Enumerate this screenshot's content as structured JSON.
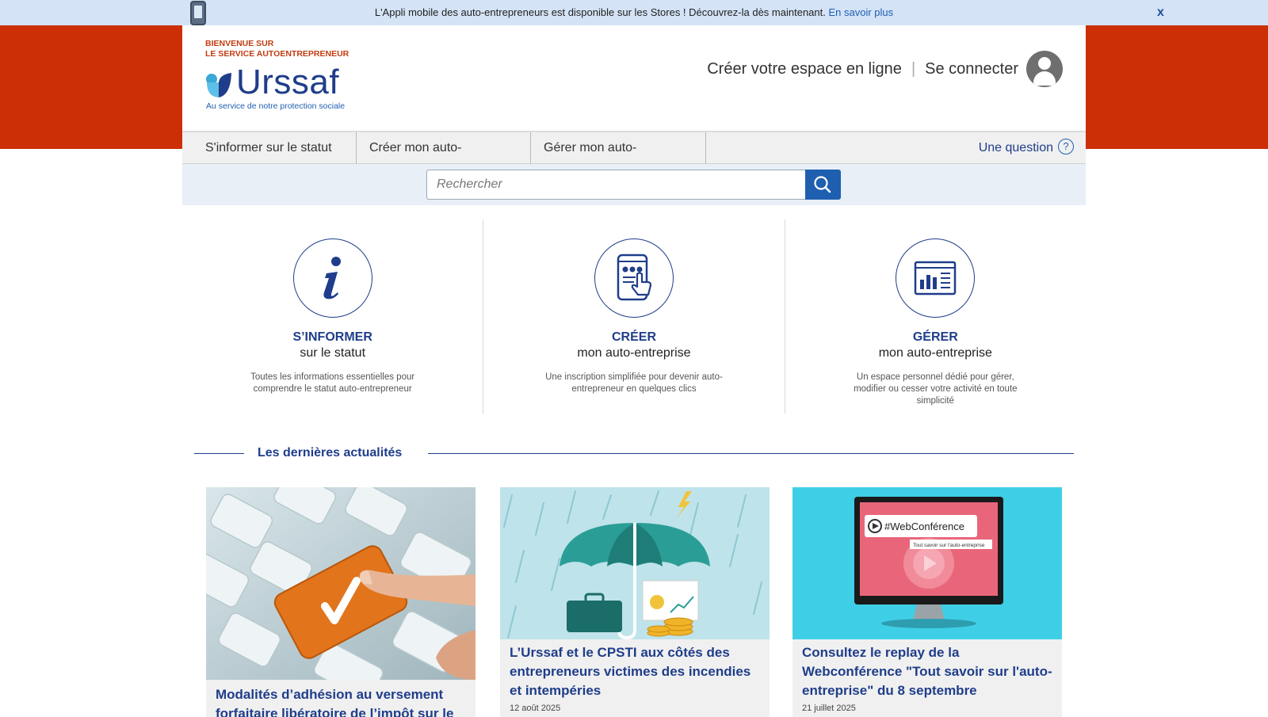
{
  "banner": {
    "text": "L'Appli mobile des auto-entrepreneurs est disponible sur les Stores ! Découvrez-la dès maintenant.",
    "link": "En savoir plus",
    "close": "x"
  },
  "header": {
    "welcome_line1": "BIENVENUE SUR",
    "welcome_line2": "LE SERVICE AUTOENTREPRENEUR",
    "logo_word": "Urssaf",
    "logo_tagline": "Au service de notre protection sociale",
    "create_space": "Créer votre espace en ligne",
    "separator": "|",
    "login": "Se connecter"
  },
  "nav": {
    "items": [
      {
        "label": "S'informer sur le statut"
      },
      {
        "label": "Créer mon auto-entreprise"
      },
      {
        "label": "Gérer mon auto-entreprise"
      }
    ],
    "question": "Une question",
    "question_icon": "?"
  },
  "search": {
    "placeholder": "Rechercher"
  },
  "features": [
    {
      "icon": "info-icon",
      "title": "S’INFORMER",
      "subtitle": "sur le statut",
      "description": "Toutes les informations essentielles pour comprendre le statut auto-entrepreneur"
    },
    {
      "icon": "tablet-touch-icon",
      "title": "CRÉER",
      "subtitle": "mon auto-entreprise",
      "description": "Une inscription simplifiée pour devenir auto-entrepreneur en quelques clics"
    },
    {
      "icon": "dashboard-icon",
      "title": "GÉRER",
      "subtitle": "mon auto-entreprise",
      "description": "Un espace personnel dédié pour gérer, modifier ou cesser votre activité en toute simplicité"
    }
  ],
  "news": {
    "heading": "Les dernières actualités",
    "cards": [
      {
        "title": "Modalités d’adhésion au versement forfaitaire libératoire de l’impôt sur le",
        "date": ""
      },
      {
        "title": "L’Urssaf et le CPSTI aux côtés des entrepreneurs victimes des incendies et intempéries",
        "date": "12 août 2025"
      },
      {
        "title": "Consultez le replay de la Webconférence \"Tout savoir sur l'auto-entreprise\" du 8 septembre",
        "date": "21 juillet 2025"
      }
    ],
    "webconf_tag": "#WebConférence",
    "webconf_sub": "Tout savoir sur l'auto-entreprise"
  },
  "colors": {
    "brand_red": "#cc2f06",
    "brand_blue": "#1f3d8a",
    "link_blue": "#1f5fb0",
    "banner_bg": "#d4e3f6"
  }
}
